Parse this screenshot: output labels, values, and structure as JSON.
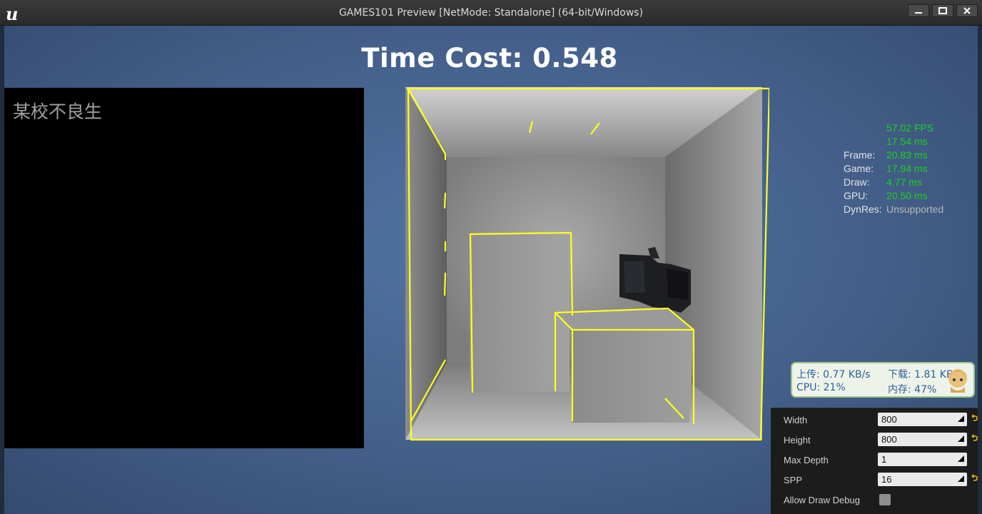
{
  "window": {
    "title": "GAMES101 Preview [NetMode: Standalone]  (64-bit/Windows)",
    "logo_icon": "unreal-logo-icon"
  },
  "hud": {
    "time_cost": "Time Cost: 0.548"
  },
  "left_panel": {
    "text": "某校不良生"
  },
  "stats": {
    "fps": "57.02 FPS",
    "ms": "17.54 ms",
    "rows": [
      {
        "label": "Frame:",
        "value": "20.83 ms"
      },
      {
        "label": "Game:",
        "value": "17.94 ms"
      },
      {
        "label": "Draw:",
        "value": "4.77 ms"
      },
      {
        "label": "GPU:",
        "value": "20.50 ms"
      },
      {
        "label": "DynRes:",
        "value": "Unsupported"
      }
    ],
    "value_color": "#19d419"
  },
  "net_monitor": {
    "upload": "上传: 0.77 KB/s",
    "download": "下载: 1.81 KB/s",
    "cpu": "CPU: 21%",
    "memory": "内存: 47%",
    "avatar_icon": "anime-avatar-icon"
  },
  "settings": {
    "rows": [
      {
        "label": "Width",
        "value": "800"
      },
      {
        "label": "Height",
        "value": "800"
      },
      {
        "label": "Max Depth",
        "value": "1"
      },
      {
        "label": "SPP",
        "value": "16"
      }
    ],
    "allow_draw_debug": {
      "label": "Allow Draw Debug",
      "checked": false
    }
  },
  "colors": {
    "debug_lines": "#ffff1e",
    "viewport_bg": "#4a6895"
  }
}
